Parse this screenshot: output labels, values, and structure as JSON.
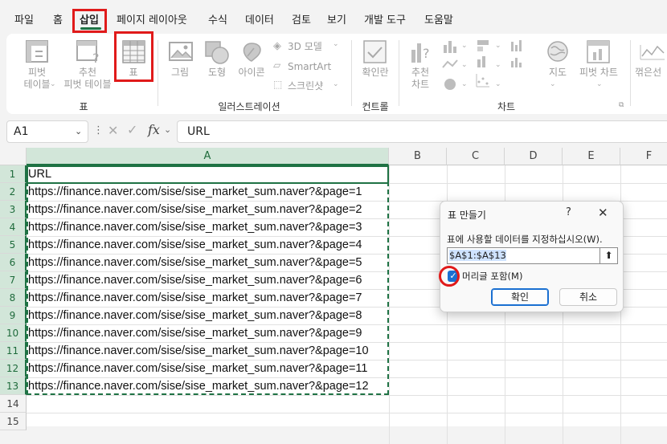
{
  "tabs": [
    "파일",
    "홈",
    "삽입",
    "페이지 레이아웃",
    "수식",
    "데이터",
    "검토",
    "보기",
    "개발 도구",
    "도움말"
  ],
  "ribbon": {
    "pivot_table": "피벗\n테이블",
    "recommended_pivot": "추천\n피벗 테이블",
    "table": "표",
    "picture": "그림",
    "shapes": "도형",
    "icons": "아이콘",
    "models_3d": "3D 모델",
    "smartart": "SmartArt",
    "screenshot": "스크린샷",
    "checkbox": "확인란",
    "recommended_charts": "추천\n차트",
    "maps": "지도",
    "pivot_chart": "피벗 차트",
    "sparklines": "꺾은선",
    "group_tables": "표",
    "group_illustrations": "일러스트레이션",
    "group_controls": "컨트롤",
    "group_charts": "차트"
  },
  "formula_bar": {
    "name_box": "A1",
    "fx": "fx",
    "content": "URL"
  },
  "columns": [
    "A",
    "B",
    "C",
    "D",
    "E",
    "F"
  ],
  "rows": [
    "1",
    "2",
    "3",
    "4",
    "5",
    "6",
    "7",
    "8",
    "9",
    "10",
    "11",
    "12",
    "13",
    "14",
    "15"
  ],
  "cells": [
    "URL",
    "https://finance.naver.com/sise/sise_market_sum.naver?&page=1",
    "https://finance.naver.com/sise/sise_market_sum.naver?&page=2",
    "https://finance.naver.com/sise/sise_market_sum.naver?&page=3",
    "https://finance.naver.com/sise/sise_market_sum.naver?&page=4",
    "https://finance.naver.com/sise/sise_market_sum.naver?&page=5",
    "https://finance.naver.com/sise/sise_market_sum.naver?&page=6",
    "https://finance.naver.com/sise/sise_market_sum.naver?&page=7",
    "https://finance.naver.com/sise/sise_market_sum.naver?&page=8",
    "https://finance.naver.com/sise/sise_market_sum.naver?&page=9",
    "https://finance.naver.com/sise/sise_market_sum.naver?&page=10",
    "https://finance.naver.com/sise/sise_market_sum.naver?&page=11",
    "https://finance.naver.com/sise/sise_market_sum.naver?&page=12"
  ],
  "dialog": {
    "title": "표 만들기",
    "help": "?",
    "close": "✕",
    "prompt": "표에 사용할 데이터를 지정하십시오(W).",
    "range": "$A$1:$A$13",
    "checkbox_label": "머리글 포함(M)",
    "checkbox_checked": true,
    "ok": "확인",
    "cancel": "취소"
  },
  "colors": {
    "accent": "#1f7244",
    "annotation": "#e01a1a",
    "dialog_primary": "#1a6fd1"
  }
}
